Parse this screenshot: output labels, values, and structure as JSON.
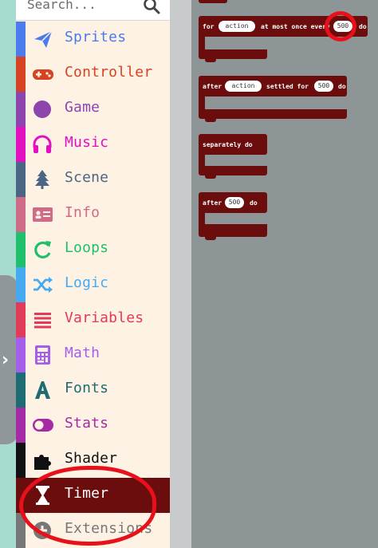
{
  "search": {
    "placeholder": "Search..."
  },
  "categories": [
    {
      "label": "Sprites",
      "color": "#4b7bec",
      "icon": "paper-plane-icon"
    },
    {
      "label": "Controller",
      "color": "#d54322",
      "icon": "gamepad-icon"
    },
    {
      "label": "Game",
      "color": "#8e44ad",
      "icon": "circle-icon"
    },
    {
      "label": "Music",
      "color": "#e30fc0",
      "icon": "headphones-icon"
    },
    {
      "label": "Scene",
      "color": "#4b6584",
      "icon": "tree-icon"
    },
    {
      "label": "Info",
      "color": "#cf6a87",
      "icon": "id-card-icon"
    },
    {
      "label": "Loops",
      "color": "#20bf6b",
      "icon": "refresh-icon"
    },
    {
      "label": "Logic",
      "color": "#45aaf2",
      "icon": "shuffle-icon"
    },
    {
      "label": "Variables",
      "color": "#e23a59",
      "icon": "list-icon"
    },
    {
      "label": "Math",
      "color": "#a55eea",
      "icon": "calculator-icon"
    },
    {
      "label": "Fonts",
      "color": "#1e6b72",
      "icon": "font-icon"
    },
    {
      "label": "Stats",
      "color": "#a52aa5",
      "icon": "toggle-icon"
    },
    {
      "label": "Shader",
      "color": "#111111",
      "icon": "puzzle-icon"
    },
    {
      "label": "Timer",
      "color": "#6c0d0d",
      "icon": "hourglass-icon",
      "selected": true
    },
    {
      "label": "Extensions",
      "color": "#777777",
      "icon": "plus-circle-icon"
    }
  ],
  "blocks": [
    {
      "prefix": "for",
      "var": "action",
      "mid": "at most once every",
      "value": "500",
      "suffix": "do"
    },
    {
      "prefix": "after",
      "var": "action",
      "mid": "settled for",
      "value": "500",
      "suffix": "do"
    },
    {
      "label": "separately do"
    },
    {
      "prefix": "after",
      "value": "500",
      "suffix": "do"
    }
  ],
  "colors": {
    "timer_block": "#6c0d0d",
    "annotation": "#e8101a",
    "toolbox_bg": "#fdf2e3",
    "workspace_bg": "#8d9597"
  }
}
